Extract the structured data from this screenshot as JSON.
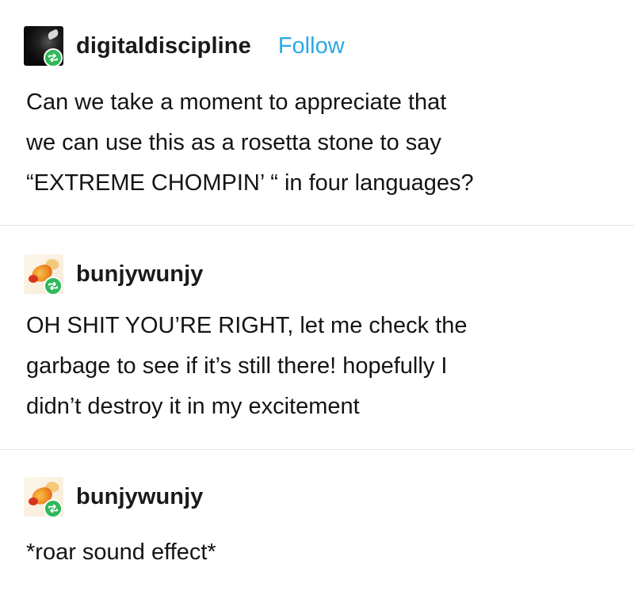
{
  "posts": [
    {
      "username": "digitaldiscipline",
      "follow_label": "Follow",
      "avatar_icon": "dark-portrait-avatar",
      "badge_icon": "reblog-icon",
      "lines": [
        "Can we take a moment to appreciate that",
        "we can use this as a rosetta stone to say",
        "“EXTREME CHOMPIN’ “ in four languages?"
      ]
    },
    {
      "username": "bunjywunjy",
      "avatar_icon": "goldfish-avatar",
      "badge_icon": "reblog-icon",
      "lines": [
        "OH SHIT YOU’RE RIGHT, let me check the",
        "garbage to see if it’s still there! hopefully I",
        "didn’t destroy it in my excitement"
      ]
    },
    {
      "username": "bunjywunjy",
      "avatar_icon": "goldfish-avatar",
      "badge_icon": "reblog-icon",
      "lines": [
        "*roar sound effect*"
      ]
    }
  ],
  "colors": {
    "follow": "#2aa8e8",
    "reblog_badge": "#2fb85a",
    "divider": "#e4e4e4",
    "text": "#141414"
  }
}
